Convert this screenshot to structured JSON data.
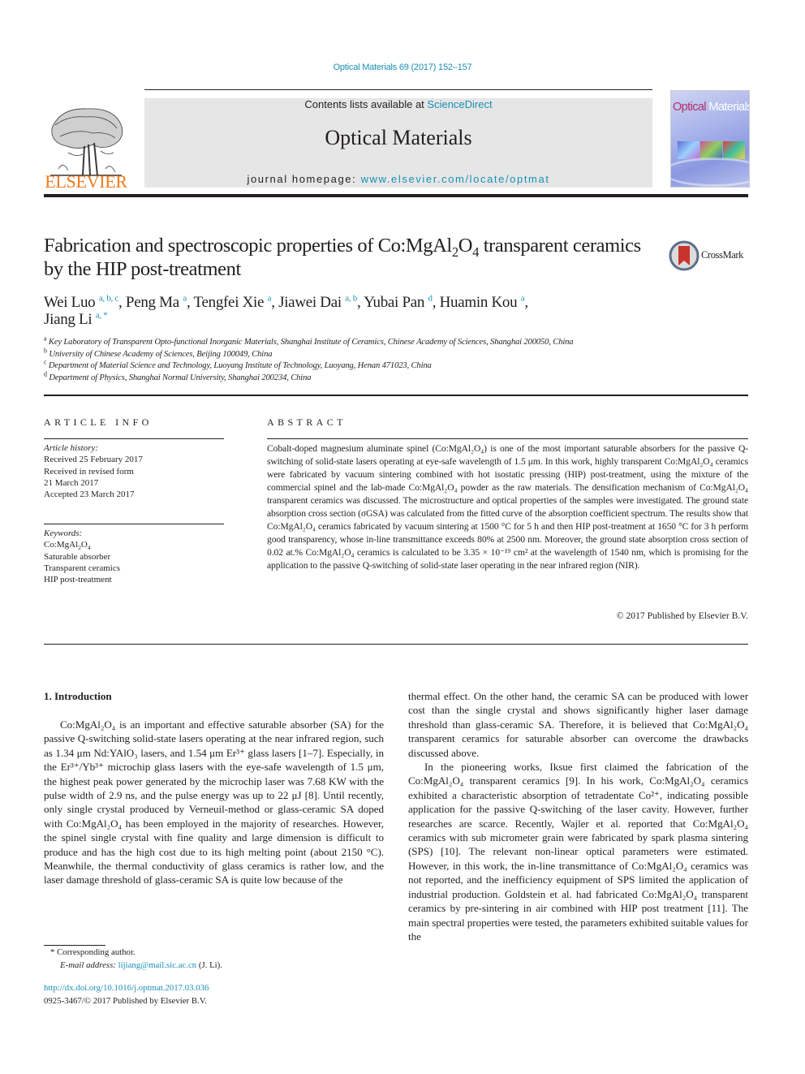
{
  "header": {
    "citation": "Optical Materials 69 (2017) 152–157",
    "contents_prefix": "Contents lists available at ",
    "contents_link": "ScienceDirect",
    "journal_name": "Optical Materials",
    "homepage_prefix": "journal homepage: ",
    "homepage_link": "www.elsevier.com/locate/optmat",
    "publisher_logo": "ELSEVIER",
    "cover_title_1": "Optical",
    "cover_title_2": " Materials",
    "brand_color": "#f07a1d",
    "link_color": "#1a8fb5"
  },
  "article": {
    "title_a": "Fabrication and spectroscopic properties of Co:MgAl",
    "title_sub1": "2",
    "title_b": "O",
    "title_sub2": "4",
    "title_c": " transparent ceramics by the HIP post-treatment",
    "crossmark_label": "CrossMark",
    "authors": [
      {
        "name": "Wei Luo",
        "aff": "a, b, c"
      },
      {
        "name": "Peng Ma",
        "aff": "a"
      },
      {
        "name": "Tengfei Xie",
        "aff": "a"
      },
      {
        "name": "Jiawei Dai",
        "aff": "a, b"
      },
      {
        "name": "Yubai Pan",
        "aff": "d"
      },
      {
        "name": "Huamin Kou",
        "aff": "a"
      },
      {
        "name": "Jiang Li",
        "aff": "a, *"
      }
    ],
    "affiliations": [
      {
        "key": "a",
        "text": "Key Laboratory of Transparent Opto-functional Inorganic Materials, Shanghai Institute of Ceramics, Chinese Academy of Sciences, Shanghai 200050, China"
      },
      {
        "key": "b",
        "text": "University of Chinese Academy of Sciences, Beijing 100049, China"
      },
      {
        "key": "c",
        "text": "Department of Material Science and Technology, Luoyang Institute of Technology, Luoyang, Henan 471023, China"
      },
      {
        "key": "d",
        "text": "Department of Physics, Shanghai Normal University, Shanghai 200234, China"
      }
    ]
  },
  "article_info": {
    "heading": "ARTICLE INFO",
    "history_label": "Article history:",
    "history": [
      "Received 25 February 2017",
      "Received in revised form",
      "21 March 2017",
      "Accepted 23 March 2017"
    ],
    "keywords_label": "Keywords:",
    "keywords": [
      "Co:MgAl2O4",
      "Saturable absorber",
      "Transparent ceramics",
      "HIP post-treatment"
    ]
  },
  "abstract": {
    "heading": "ABSTRACT",
    "text": "Cobalt-doped magnesium aluminate spinel (Co:MgAl₂O₄) is one of the most important saturable absorbers for the passive Q-switching of solid-state lasers operating at eye-safe wavelength of 1.5 μm. In this work, highly transparent Co:MgAl₂O₄ ceramics were fabricated by vacuum sintering combined with hot isostatic pressing (HIP) post-treatment, using the mixture of the commercial spinel and the lab-made Co:MgAl₂O₄ powder as the raw materials. The densification mechanism of Co:MgAl₂O₄ transparent ceramics was discussed. The microstructure and optical properties of the samples were investigated. The ground state absorption cross section (σGSA) was calculated from the fitted curve of the absorption coefficient spectrum. The results show that Co:MgAl₂O₄ ceramics fabricated by vacuum sintering at 1500 °C for 5 h and then HIP post-treatment at 1650 °C for 3 h perform good transparency, whose in-line transmittance exceeds 80% at 2500 nm. Moreover, the ground state absorption cross section of 0.02 at.% Co:MgAl₂O₄ ceramics is calculated to be 3.35 × 10⁻¹⁹ cm² at the wavelength of 1540 nm, which is promising for the application to the passive Q-switching of solid-state laser operating in the near infrared region (NIR).",
    "copyright": "© 2017 Published by Elsevier B.V."
  },
  "body": {
    "section_heading": "1.  Introduction",
    "left_column": "Co:MgAl₂O₄ is an important and effective saturable absorber (SA) for the passive Q-switching solid-state lasers operating at the near infrared region, such as 1.34 μm Nd:YAlO₃ lasers, and 1.54 μm Er³⁺ glass lasers [1–7]. Especially, in the Er³⁺/Yb³⁺ microchip glass lasers with the eye-safe wavelength of 1.5 μm, the highest peak power generated by the microchip laser was 7.68 KW with the pulse width of 2.9 ns, and the pulse energy was up to 22 μJ [8]. Until recently, only single crystal produced by Verneuil-method or glass-ceramic SA doped with Co:MgAl₂O₄ has been employed in the majority of researches. However, the spinel single crystal with fine quality and large dimension is difficult to produce and has the high cost due to its high melting point (about 2150 °C). Meanwhile, the thermal conductivity of glass ceramics is rather low, and the laser damage threshold of glass-ceramic SA is quite low because of the",
    "right_column_p1": "thermal effect. On the other hand, the ceramic SA can be produced with lower cost than the single crystal and shows significantly higher laser damage threshold than glass-ceramic SA. Therefore, it is believed that Co:MgAl₂O₄ transparent ceramics for saturable absorber can overcome the drawbacks discussed above.",
    "right_column_p2": "In the pioneering works, Iksue first claimed the fabrication of the Co:MgAl₂O₄ transparent ceramics [9]. In his work, Co:MgAl₂O₄ ceramics exhibited a characteristic absorption of tetradentate Co²⁺, indicating possible application for the passive Q-switching of the laser cavity. However, further researches are scarce. Recently, Wajler et al. reported that Co:MgAl₂O₄ ceramics with sub micrometer grain were fabricated by spark plasma sintering (SPS) [10]. The relevant non-linear optical parameters were estimated. However, in this work, the in-line transmittance of Co:MgAl₂O₄ ceramics was not reported, and the inefficiency equipment of SPS limited the application of industrial production. Goldstein et al. had fabricated Co:MgAl₂O₄ transparent ceramics by pre-sintering in air combined with HIP post treatment [11]. The main spectral properties were tested, the parameters exhibited suitable values for the"
  },
  "footnotes": {
    "corresponding": "* Corresponding author.",
    "email_label": "E-mail address: ",
    "email": "lijiang@mail.sic.ac.cn",
    "email_suffix": " (J. Li).",
    "doi": "http://dx.doi.org/10.1016/j.optmat.2017.03.036",
    "issn_line": "0925-3467/© 2017 Published by Elsevier B.V."
  }
}
